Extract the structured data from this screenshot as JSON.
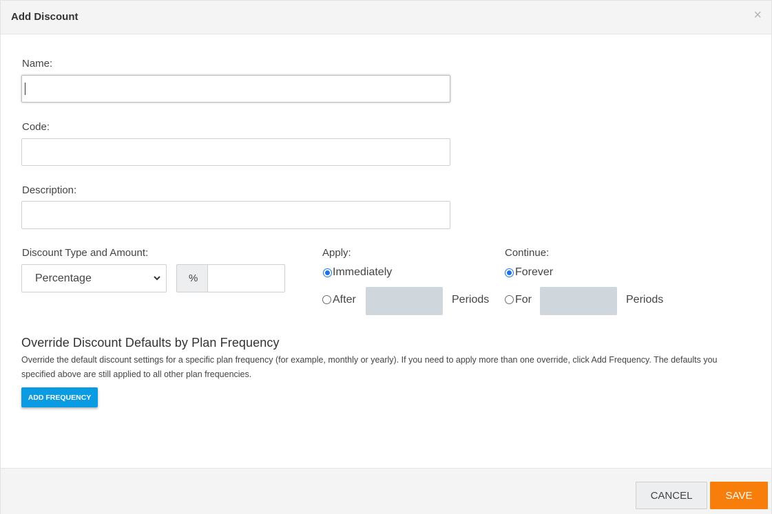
{
  "dialog": {
    "title": "Add Discount",
    "close_glyph": "×"
  },
  "form": {
    "name": {
      "label": "Name:",
      "value": ""
    },
    "code": {
      "label": "Code:",
      "value": ""
    },
    "description": {
      "label": "Description:",
      "value": ""
    },
    "discount": {
      "label": "Discount Type and Amount:",
      "type_selected": "Percentage",
      "unit_symbol": "%",
      "amount": ""
    },
    "apply": {
      "label": "Apply:",
      "options": [
        {
          "label": "Immediately",
          "checked": true
        },
        {
          "label": "After",
          "checked": false
        }
      ],
      "periods_label": "Periods"
    },
    "continue": {
      "label": "Continue:",
      "options": [
        {
          "label": "Forever",
          "checked": true
        },
        {
          "label": "For",
          "checked": false
        }
      ],
      "periods_label": "Periods"
    }
  },
  "override": {
    "title": "Override Discount Defaults by Plan Frequency",
    "description": "Override the default discount settings for a specific plan frequency (for example, monthly or yearly). If you need to apply more than one override, click Add Frequency. The defaults you specified above are still applied to all other plan frequencies.",
    "add_button": "ADD FREQUENCY"
  },
  "footer": {
    "cancel_label": "CANCEL",
    "save_label": "SAVE"
  },
  "colors": {
    "accent_blue": "#0a9be3",
    "save_orange": "#f77e0b",
    "radio_blue": "#1a73e8"
  },
  "icons": {
    "close": "close-icon",
    "select_chevron": "chevron-down-icon"
  }
}
